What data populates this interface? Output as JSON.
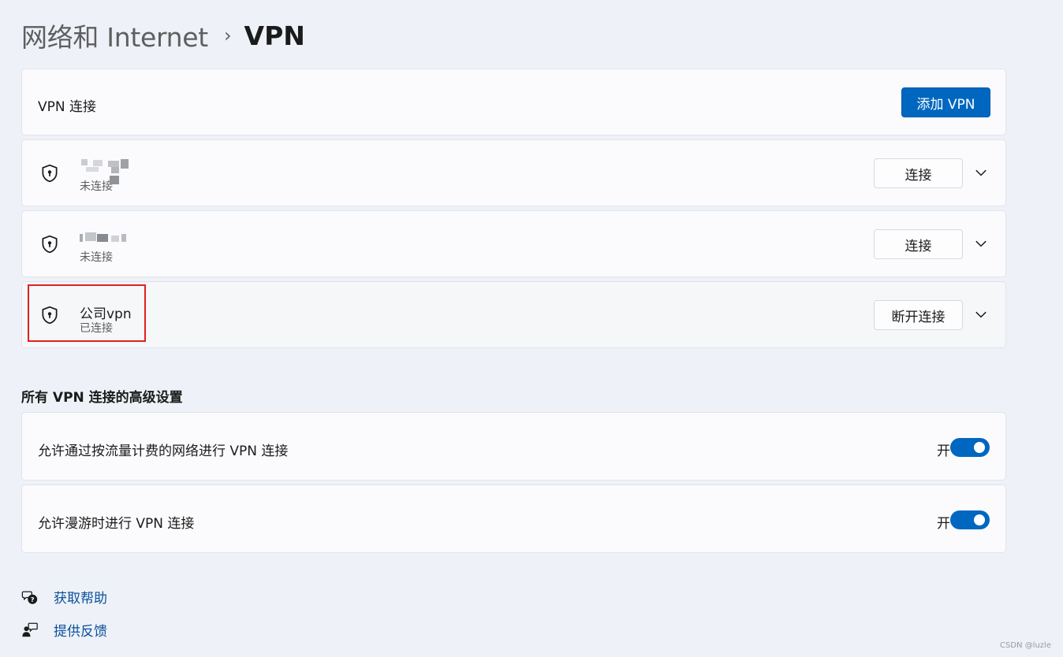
{
  "breadcrumb": {
    "parent": "网络和 Internet",
    "separator": "›",
    "current": "VPN"
  },
  "vpn_header": {
    "label": "VPN 连接",
    "add_button": "添加 VPN"
  },
  "vpn_connections": [
    {
      "name": "",
      "status": "未连接",
      "action": "连接"
    },
    {
      "name": "",
      "status": "未连接",
      "action": "连接"
    },
    {
      "name": "公司vpn",
      "status": "已连接",
      "action": "断开连接"
    }
  ],
  "advanced": {
    "heading": "所有 VPN 连接的高级设置",
    "settings": [
      {
        "label": "允许通过按流量计费的网络进行 VPN 连接",
        "state": "开",
        "on": true
      },
      {
        "label": "允许漫游时进行 VPN 连接",
        "state": "开",
        "on": true
      }
    ]
  },
  "links": {
    "help": "获取帮助",
    "feedback": "提供反馈"
  },
  "watermark": "CSDN @luzle",
  "colors": {
    "accent": "#0067c0",
    "link": "#0a4f9c",
    "highlight": "#e02020"
  },
  "icons": [
    "vpn-shield-icon",
    "chevron-down-icon",
    "help-icon",
    "feedback-icon"
  ]
}
